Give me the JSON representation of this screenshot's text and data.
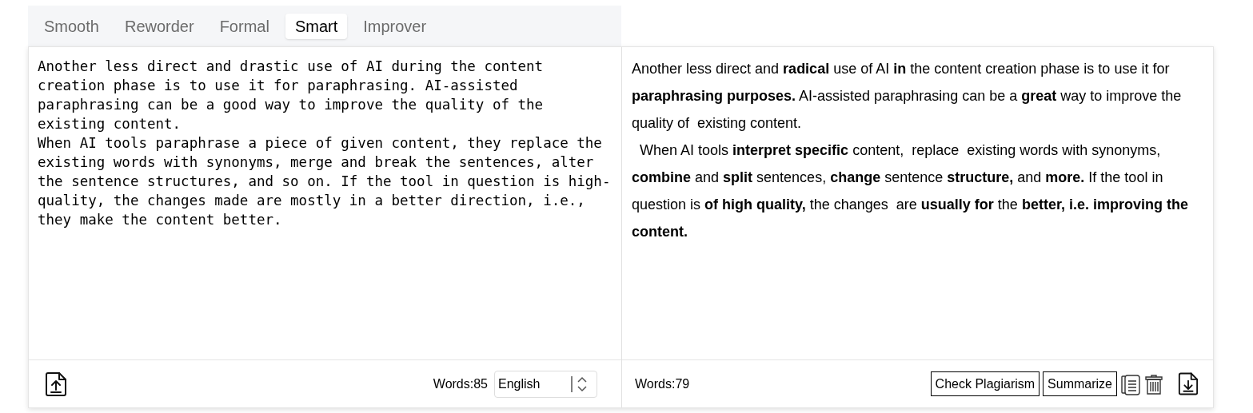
{
  "tabs": [
    {
      "label": "Smooth",
      "selected": false
    },
    {
      "label": "Reworder",
      "selected": false
    },
    {
      "label": "Formal",
      "selected": false
    },
    {
      "label": "Smart",
      "selected": true
    },
    {
      "label": "Improver",
      "selected": false
    }
  ],
  "input": {
    "paragraphs": [
      "Another less direct and drastic use of AI during the content creation phase is to use it for paraphrasing. AI-assisted paraphrasing can be a good way to improve the quality of the existing content.",
      "When AI tools paraphrase a piece of given content, they replace the existing words with synonyms, merge and break the sentences, alter the sentence structures, and so on. If the tool in question is high-quality, the changes made are mostly in a better direction, i.e., they make the content better."
    ],
    "word_count": "Words:85",
    "language": "English"
  },
  "output": {
    "paragraphs": [
      "Another less direct and **radical** use of AI **in** the content creation phase is to use it for **paraphrasing purposes.** AI-assisted paraphrasing can be a **great** way to improve the quality of  existing content.",
      "  When AI tools **interpret specific** content,  replace  existing words with synonyms, **combine** and **split** sentences, **change** sentence **structure,** and **more.** If the tool in question is **of high quality,** the changes  are **usually for** the **better, i.e. improving the content.**"
    ],
    "word_count": "Words:79",
    "buttons": [
      "Check Plagiarism",
      "Summarize"
    ]
  }
}
